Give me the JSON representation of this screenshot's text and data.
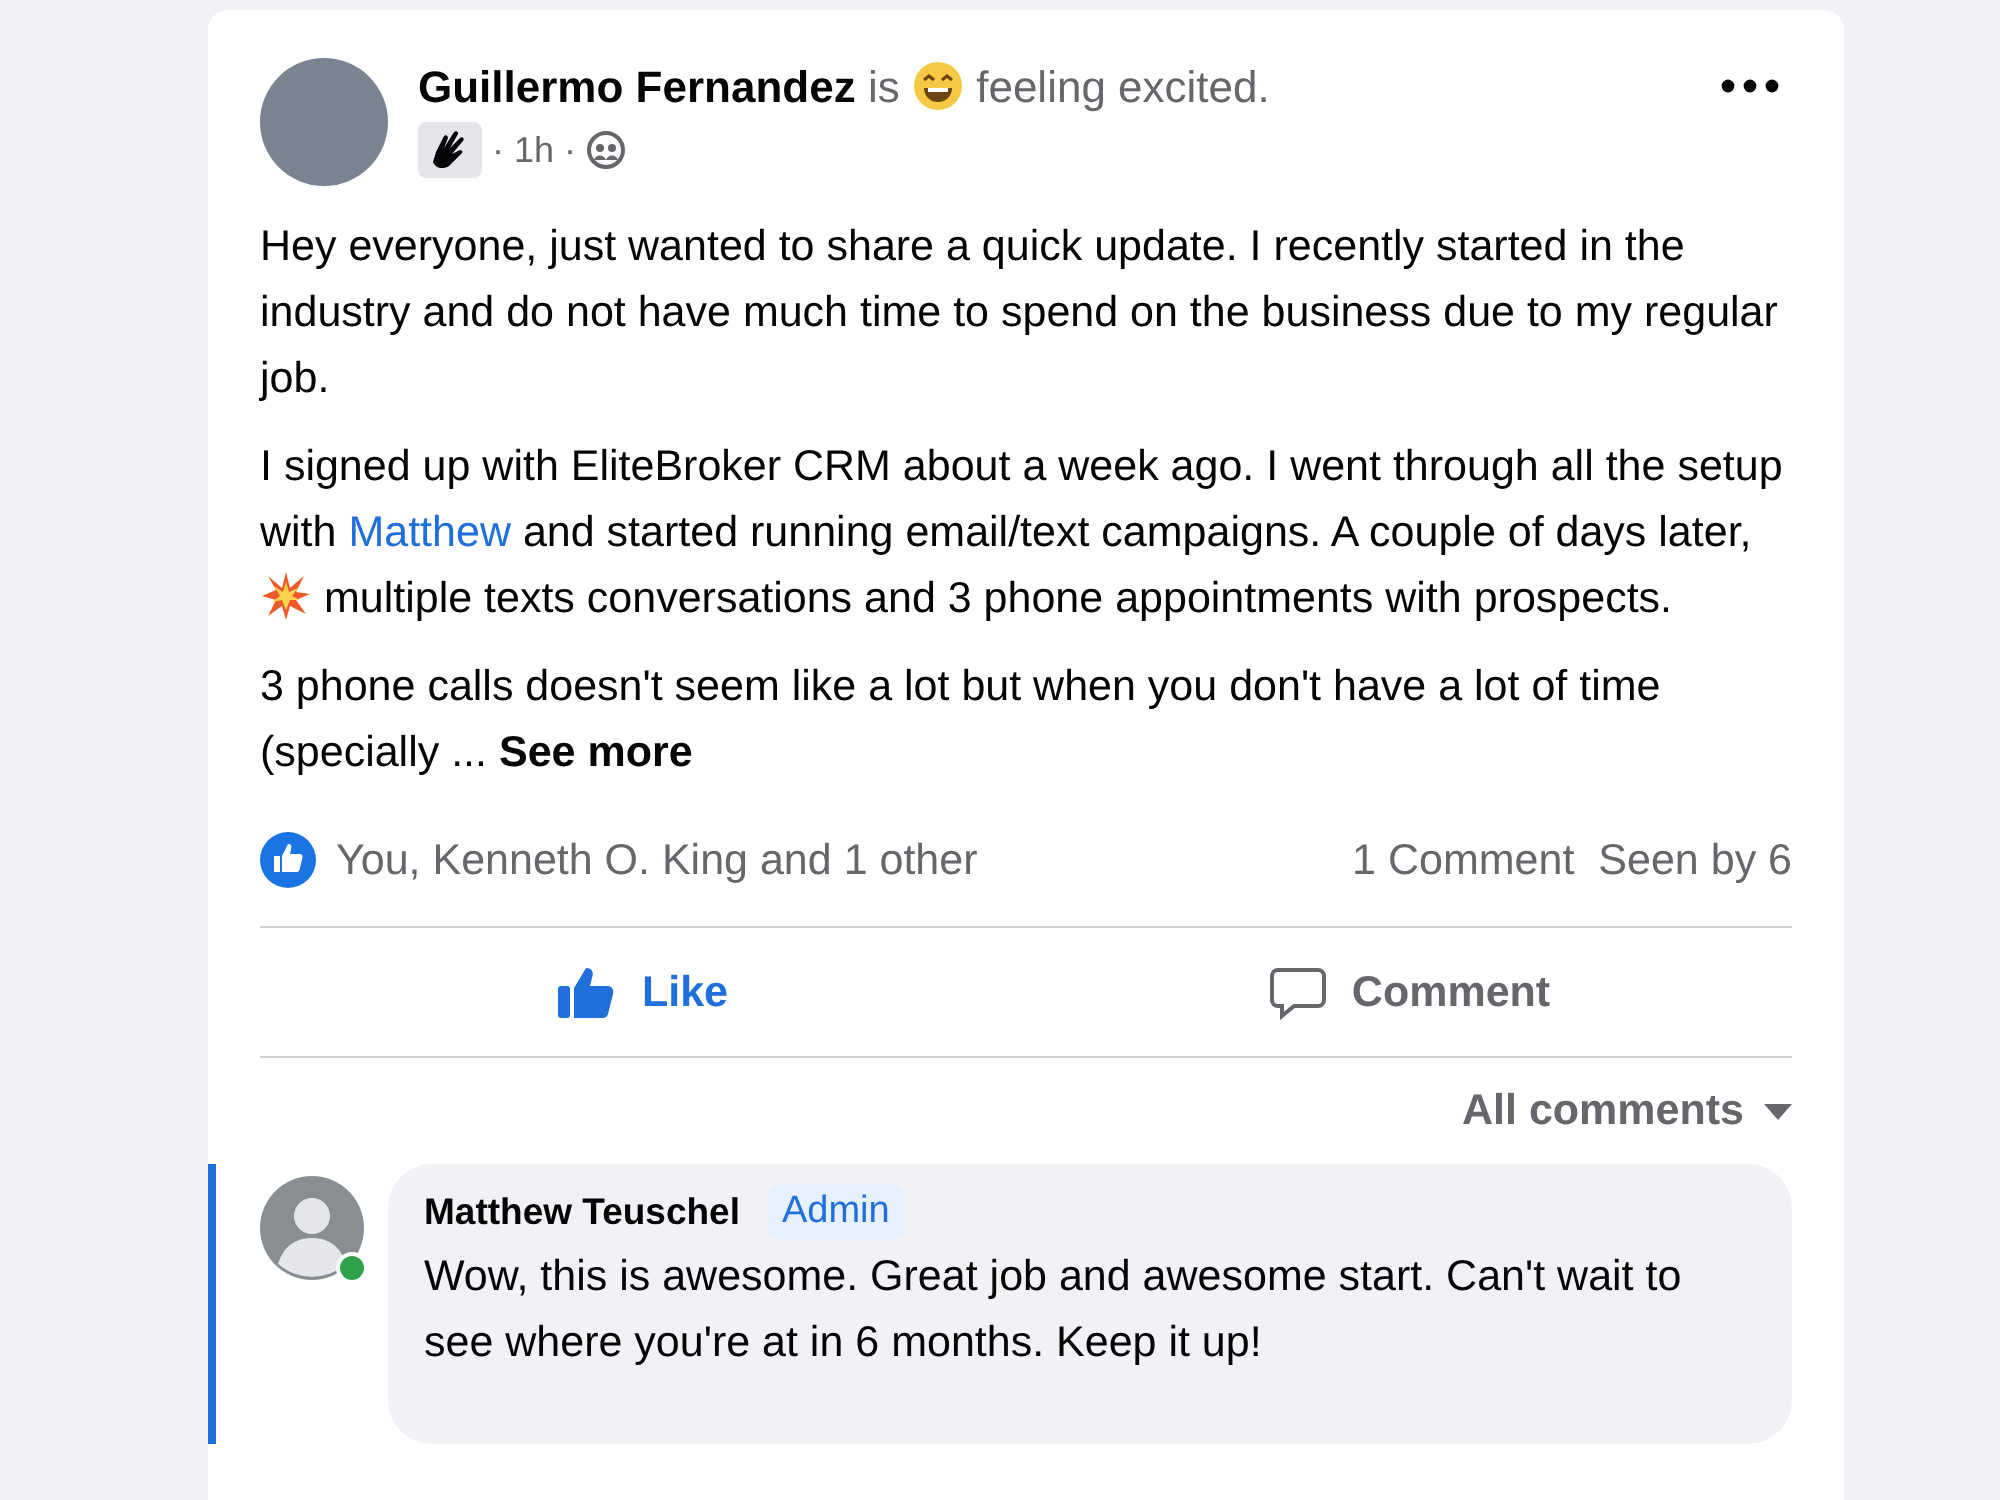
{
  "post": {
    "author": "Guillermo Fernandez",
    "activity_verb": "is",
    "feeling": "feeling excited.",
    "time": "1h",
    "separator": "·",
    "paragraphs": [
      [
        {
          "kind": "text",
          "text": "Hey everyone, just wanted to share a quick update. I recently started in the industry and do not have much time to spend on the business due to my regular job."
        }
      ],
      [
        {
          "kind": "text",
          "text": "I signed up with EliteBroker CRM about a week ago. I went through all the setup with "
        },
        {
          "kind": "link",
          "text": "Matthew"
        },
        {
          "kind": "text",
          "text": " and started running email/text campaigns. A couple of days later, "
        },
        {
          "kind": "icon"
        },
        {
          "kind": "text",
          "text": " multiple texts conversations and 3 phone appointments with prospects."
        }
      ],
      [
        {
          "kind": "text",
          "text": "3 phone calls doesn't seem like a lot but when you don't have a lot of time (specially ... "
        },
        {
          "kind": "more",
          "text": "See more"
        }
      ]
    ],
    "reactions": "You, Kenneth O. King and 1 other",
    "comment_count": "1 Comment",
    "seen_by": "Seen by 6",
    "actions": [
      {
        "kind": "like",
        "label": "Like",
        "selected": true
      },
      {
        "kind": "comment",
        "label": "Comment",
        "selected": false
      }
    ],
    "comment_filter": "All comments"
  },
  "comments": [
    {
      "author": "Matthew Teuschel",
      "badge": "Admin",
      "online": true,
      "highlighted": true,
      "text": "Wow, this is awesome. Great job and awesome start. Can't wait to see where you're at in 6 months. Keep it up!"
    }
  ]
}
